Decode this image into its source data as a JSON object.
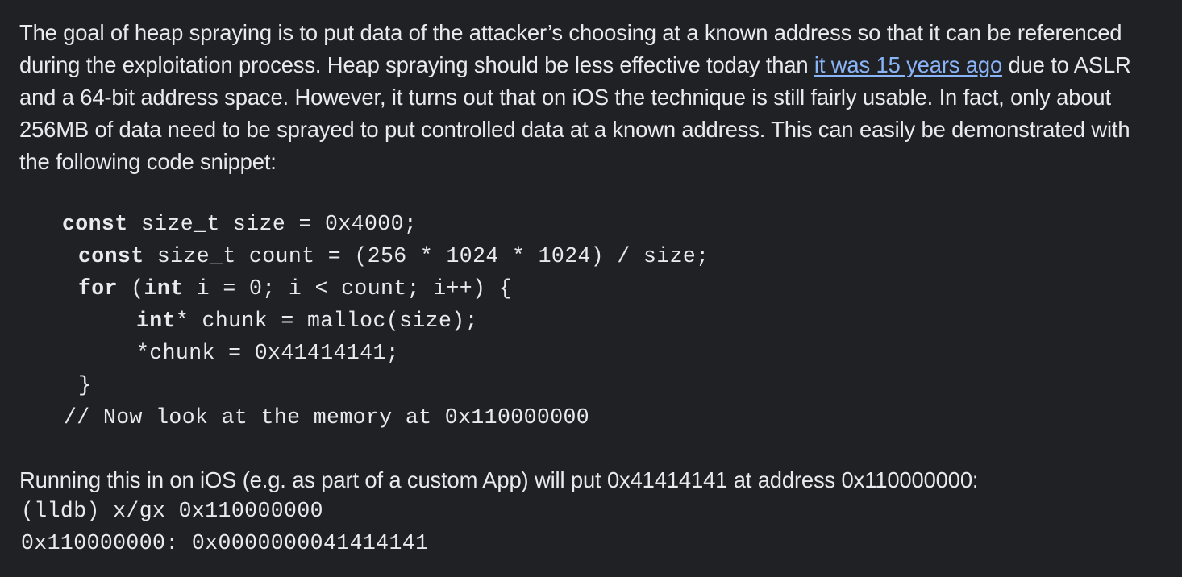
{
  "intro": {
    "text_before_link": "The goal of heap spraying is to put data of the attacker’s choosing at a known address so that it can be referenced during the exploitation process. Heap spraying should be less effective today than ",
    "link_text": "it was 15 years ago",
    "text_after_link": " due to ASLR and a 64-bit address space. However, it turns out that on iOS the technique is still fairly usable. In fact, only about 256MB of data need to be sprayed to put controlled data at a known address. This can easily be demonstrated with the following code snippet:"
  },
  "code": {
    "line1_kw": "const",
    "line1_rest": " size_t size = 0x4000;",
    "line2_kw": "const",
    "line2_rest": " size_t count = (256 * 1024 * 1024) / size;",
    "line3_kw": "for",
    "line3_mid": " (",
    "line3_kw2": "int",
    "line3_rest": " i = 0; i < count; i++) {",
    "line4_kw": "int",
    "line4_rest": "* chunk = malloc(size);",
    "line5": "*chunk = 0x41414141;",
    "line6": "}",
    "line7": "// Now look at the memory at 0x110000000"
  },
  "result_text": "Running this in on iOS (e.g. as part of a custom App) will put 0x41414141 at address 0x110000000:",
  "lldb": {
    "command": "(lldb) x/gx 0x110000000",
    "output": "0x110000000: 0x0000000041414141"
  }
}
